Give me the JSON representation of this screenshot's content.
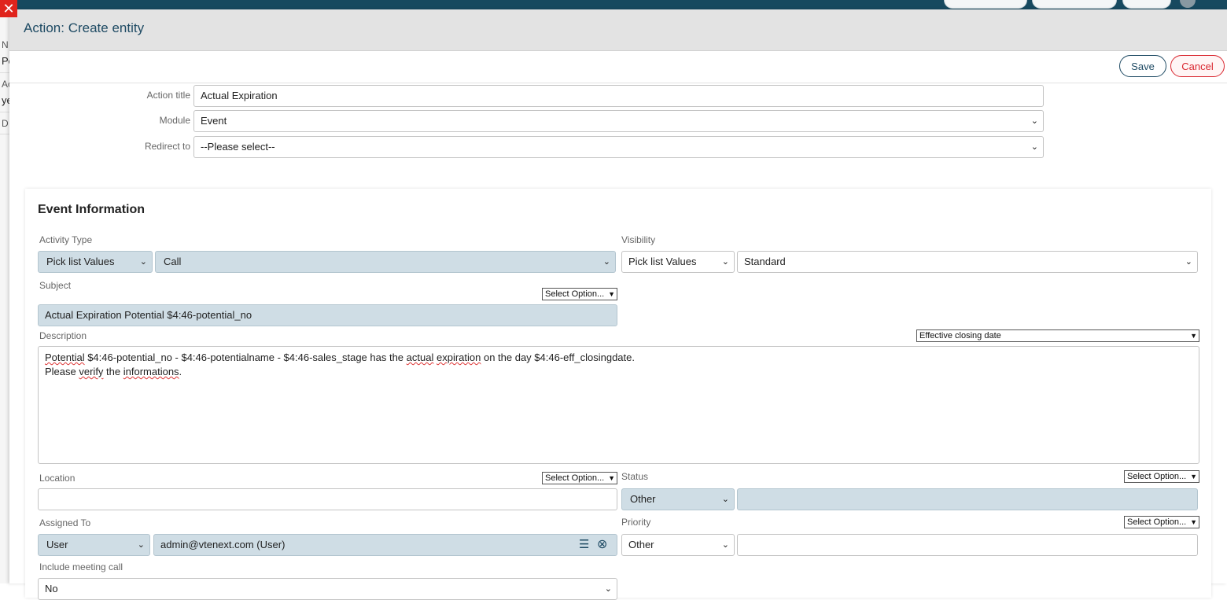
{
  "background": {
    "left_labels": [
      "N",
      "Po",
      "Ac",
      "ye",
      "D"
    ]
  },
  "modal": {
    "title": "Action: Create entity",
    "save_label": "Save",
    "cancel_label": "Cancel"
  },
  "form": {
    "action_title_label": "Action title",
    "action_title_value": "Actual Expiration",
    "module_label": "Module",
    "module_value": "Event",
    "redirect_label": "Redirect to",
    "redirect_value": "--Please select--"
  },
  "event": {
    "section_title": "Event Information",
    "activity_type_label": "Activity Type",
    "activity_type_mode": "Pick list Values",
    "activity_type_value": "Call",
    "visibility_label": "Visibility",
    "visibility_mode": "Pick list Values",
    "visibility_value": "Standard",
    "subject_label": "Subject",
    "subject_option": "Select Option...",
    "subject_value": "Actual Expiration Potential $4:46-potential_no",
    "description_label": "Description",
    "description_option": "Effective closing date",
    "description_line1": {
      "w1": "Potential",
      "t1": " $4:46-potential_no - $4:46-potentialname - $4:46-sales_stage has the ",
      "w2": "actual",
      "sp": " ",
      "w3": "expiration",
      "t2": " on the day $4:46-eff_closingdate."
    },
    "description_line2": {
      "t1": "Please ",
      "w1": "verify",
      "t2": " the ",
      "w2": "informations",
      "t3": "."
    },
    "location_label": "Location",
    "location_option": "Select Option...",
    "status_label": "Status",
    "status_option": "Select Option...",
    "status_value": "Other",
    "assigned_label": "Assigned To",
    "assigned_mode": "User",
    "assigned_value": "admin@vtenext.com (User)",
    "priority_label": "Priority",
    "priority_option": "Select Option...",
    "priority_value": "Other",
    "meeting_label": "Include meeting call",
    "meeting_value": "No"
  }
}
